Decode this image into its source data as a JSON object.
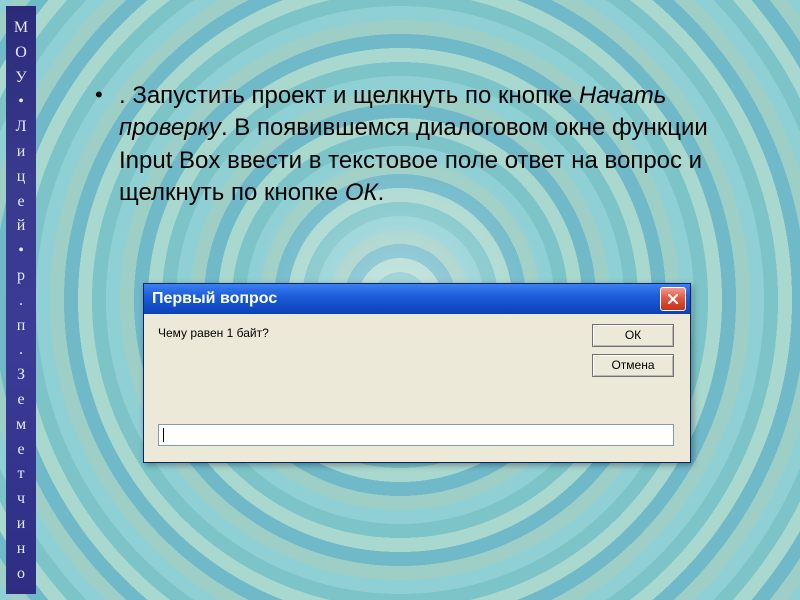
{
  "sidebar_text": "МОУ•Лицей• р.п.Земетчино",
  "bullet": {
    "prefix": ". Запустить проект и щелкнуть по кнопке ",
    "italic1": "Начать проверку",
    "mid": ". В появившемся диалоговом окне функции Input Box ввести в текстовое поле ответ на вопрос и щелкнуть по кнопке ",
    "italic2": "ОК",
    "suffix": "."
  },
  "dialog": {
    "title": "Первый вопрос",
    "question": "Чему равен 1 байт?",
    "ok_label": "ОК",
    "cancel_label": "Отмена",
    "input_value": ""
  }
}
